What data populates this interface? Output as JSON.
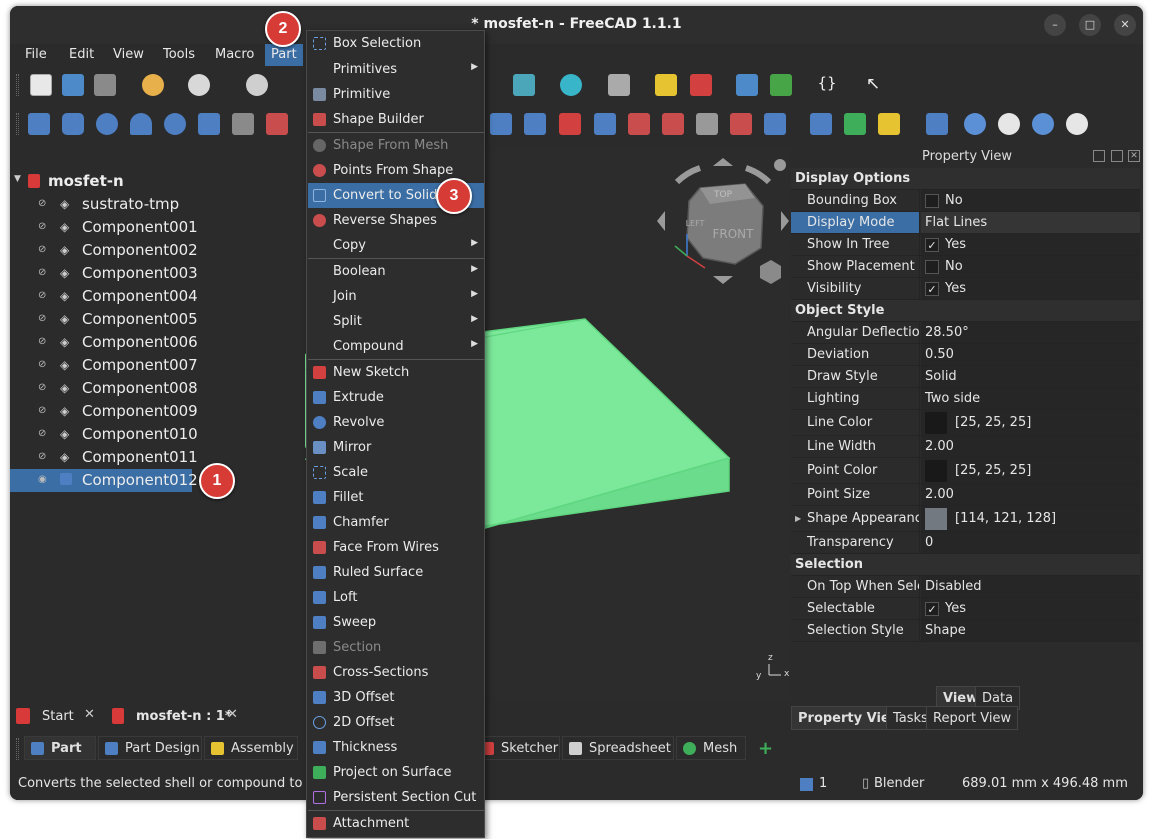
{
  "window": {
    "title": "* mosfet-n - FreeCAD 1.1.1",
    "minimize": "–",
    "maximize": "□",
    "close": "✕"
  },
  "menubar": {
    "items": [
      "File",
      "Edit",
      "View",
      "Tools",
      "Macro",
      "Part"
    ]
  },
  "tree": {
    "root": "mosfet-n",
    "items": [
      "sustrato-tmp",
      "Component001",
      "Component002",
      "Component003",
      "Component004",
      "Component005",
      "Component006",
      "Component007",
      "Component008",
      "Component009",
      "Component010",
      "Component011",
      "Component012"
    ],
    "selected": "Component012"
  },
  "navcube": {
    "top": "TOP",
    "front": "FRONT",
    "left": "LEFT"
  },
  "axes": {
    "z": "z",
    "y": "y",
    "x": "x"
  },
  "part_menu": {
    "items": [
      {
        "label": "Box Selection",
        "icon": "box-selection-icon",
        "enabled": true
      },
      {
        "label": "Primitives",
        "submenu": true,
        "enabled": true
      },
      {
        "label": "Primitive",
        "icon": "primitive-icon",
        "enabled": true
      },
      {
        "label": "Shape Builder",
        "icon": "shape-builder-icon",
        "enabled": true
      },
      {
        "label": "Shape From Mesh",
        "icon": "shape-from-mesh-icon",
        "enabled": false
      },
      {
        "label": "Points From Shape",
        "icon": "points-from-shape-icon",
        "enabled": true
      },
      {
        "label": "Convert to Solid",
        "icon": "convert-to-solid-icon",
        "enabled": true,
        "highlighted": true
      },
      {
        "label": "Reverse Shapes",
        "icon": "reverse-shapes-icon",
        "enabled": true
      },
      {
        "label": "Copy",
        "submenu": true,
        "enabled": true
      },
      {
        "label": "Boolean",
        "submenu": true,
        "enabled": true
      },
      {
        "label": "Join",
        "submenu": true,
        "enabled": true
      },
      {
        "label": "Split",
        "submenu": true,
        "enabled": true
      },
      {
        "label": "Compound",
        "submenu": true,
        "enabled": true
      },
      {
        "label": "New Sketch",
        "icon": "new-sketch-icon",
        "enabled": true
      },
      {
        "label": "Extrude",
        "icon": "extrude-icon",
        "enabled": true
      },
      {
        "label": "Revolve",
        "icon": "revolve-icon",
        "enabled": true
      },
      {
        "label": "Mirror",
        "icon": "mirror-icon",
        "enabled": true
      },
      {
        "label": "Scale",
        "icon": "scale-icon",
        "enabled": true
      },
      {
        "label": "Fillet",
        "icon": "fillet-icon",
        "enabled": true
      },
      {
        "label": "Chamfer",
        "icon": "chamfer-icon",
        "enabled": true
      },
      {
        "label": "Face From Wires",
        "icon": "face-from-wires-icon",
        "enabled": true
      },
      {
        "label": "Ruled Surface",
        "icon": "ruled-surface-icon",
        "enabled": true
      },
      {
        "label": "Loft",
        "icon": "loft-icon",
        "enabled": true
      },
      {
        "label": "Sweep",
        "icon": "sweep-icon",
        "enabled": true
      },
      {
        "label": "Section",
        "icon": "section-icon",
        "enabled": false
      },
      {
        "label": "Cross-Sections",
        "icon": "cross-sections-icon",
        "enabled": true
      },
      {
        "label": "3D Offset",
        "icon": "offset-3d-icon",
        "enabled": true
      },
      {
        "label": "2D Offset",
        "icon": "offset-2d-icon",
        "enabled": true
      },
      {
        "label": "Thickness",
        "icon": "thickness-icon",
        "enabled": true
      },
      {
        "label": "Project on Surface",
        "icon": "project-on-surface-icon",
        "enabled": true
      },
      {
        "label": "Persistent Section Cut",
        "icon": "persistent-section-cut-icon",
        "enabled": true
      },
      {
        "label": "Attachment",
        "icon": "attachment-icon",
        "enabled": true
      }
    ]
  },
  "property_view": {
    "title": "Property View",
    "groups": {
      "display_options": "Display Options",
      "object_style": "Object Style",
      "selection": "Selection"
    },
    "rows": {
      "bounding_box": {
        "key": "Bounding Box",
        "value": "No",
        "checked": false
      },
      "display_mode": {
        "key": "Display Mode",
        "value": "Flat Lines"
      },
      "show_in_tree": {
        "key": "Show In Tree",
        "value": "Yes",
        "checked": true
      },
      "show_placement": {
        "key": "Show Placement",
        "value": "No",
        "checked": false
      },
      "visibility": {
        "key": "Visibility",
        "value": "Yes",
        "checked": true
      },
      "angular_deflection": {
        "key": "Angular Deflection",
        "value": "28.50°"
      },
      "deviation": {
        "key": "Deviation",
        "value": "0.50"
      },
      "draw_style": {
        "key": "Draw Style",
        "value": "Solid"
      },
      "lighting": {
        "key": "Lighting",
        "value": "Two side"
      },
      "line_color": {
        "key": "Line Color",
        "value": "[25, 25, 25]",
        "color": "#191919"
      },
      "line_width": {
        "key": "Line Width",
        "value": "2.00"
      },
      "point_color": {
        "key": "Point Color",
        "value": "[25, 25, 25]",
        "color": "#191919"
      },
      "point_size": {
        "key": "Point Size",
        "value": "2.00"
      },
      "shape_appearance": {
        "key": "Shape Appearance",
        "value": "[114, 121, 128]",
        "color": "#727980"
      },
      "transparency": {
        "key": "Transparency",
        "value": "0"
      },
      "on_top": {
        "key": "On Top When Sele...",
        "value": "Disabled"
      },
      "selectable": {
        "key": "Selectable",
        "value": "Yes",
        "checked": true
      },
      "selection_style": {
        "key": "Selection Style",
        "value": "Shape"
      }
    },
    "subtabs": [
      "View",
      "Data"
    ],
    "bottom_tabs": [
      "Property View",
      "Tasks",
      "Report View"
    ]
  },
  "doc_tabs": [
    "Start",
    "mosfet-n : 1*"
  ],
  "workbenches": [
    "Part",
    "Part Design",
    "Assembly",
    "Sketcher",
    "Spreadsheet",
    "Mesh"
  ],
  "status": {
    "message": "Converts the selected shell or compound to a solid",
    "page": "1",
    "nav_style": "Blender",
    "dimensions": "689.01 mm x 496.48 mm"
  },
  "badges": [
    "1",
    "2",
    "3"
  ],
  "colors": {
    "accent": "#3a6ea5",
    "shape": "#7be89a",
    "badge": "#d63b35"
  }
}
